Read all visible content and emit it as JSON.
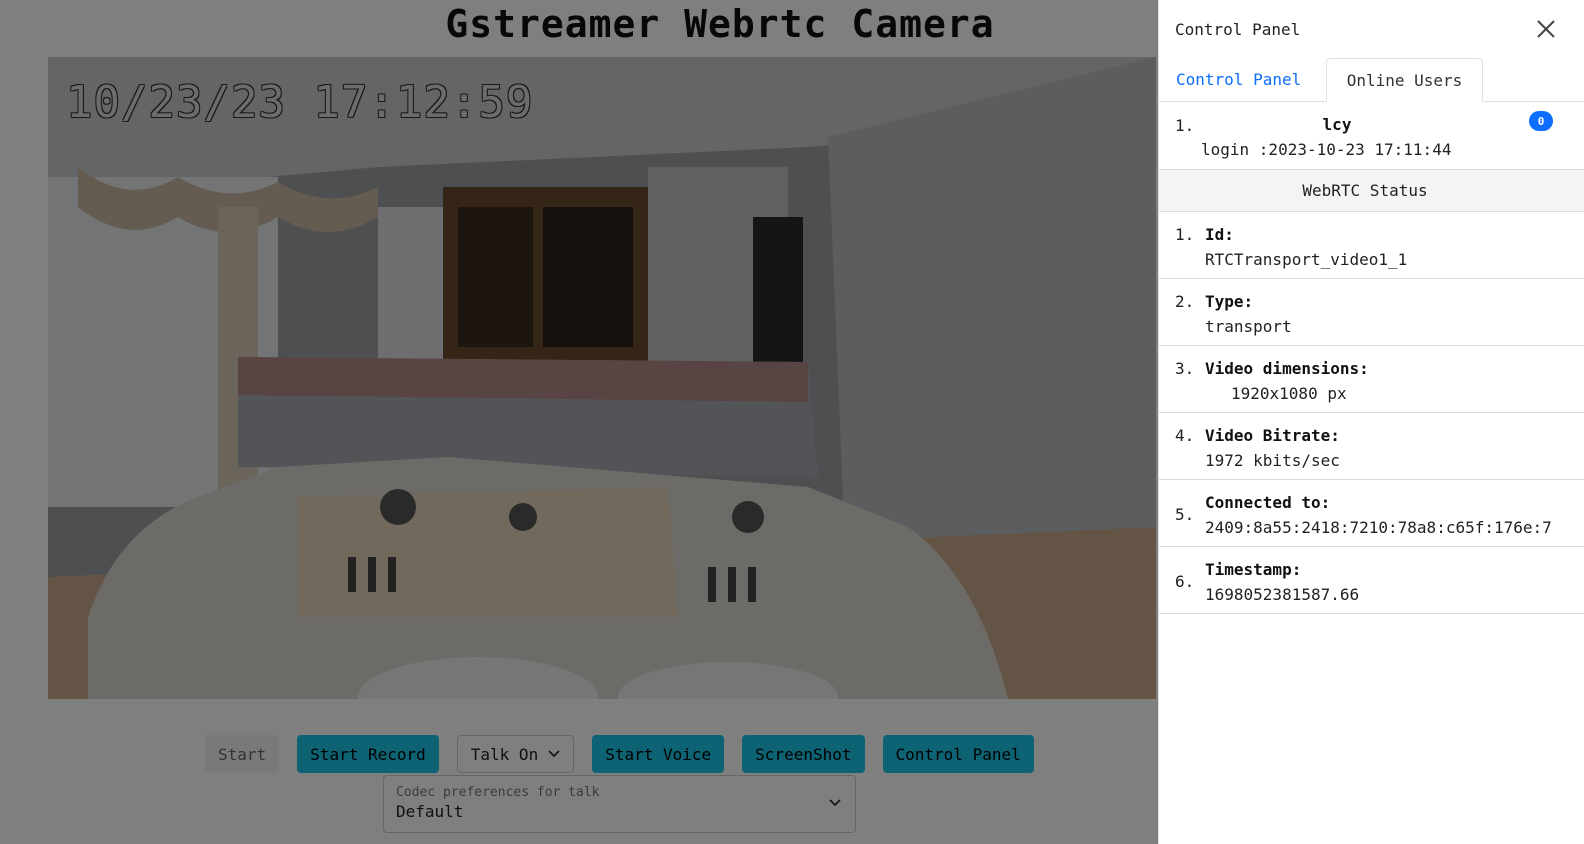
{
  "page": {
    "title": "Gstreamer Webrtc Camera",
    "video_timestamp": "10/23/23 17:12:59"
  },
  "toolbar": {
    "start_label": "Start",
    "record_label": "Start Record",
    "talk_label": "Talk On",
    "voice_label": "Start Voice",
    "screenshot_label": "ScreenShot",
    "control_panel_label": "Control Panel"
  },
  "codec": {
    "label": "Codec preferences for talk",
    "value": "Default"
  },
  "panel": {
    "title": "Control Panel",
    "tabs": [
      {
        "label": "Control Panel",
        "active": false
      },
      {
        "label": "Online Users",
        "active": true
      }
    ],
    "users": [
      {
        "index": "1.",
        "name": "lcy",
        "login": "login :2023-10-23 17:11:44",
        "badge": "0"
      }
    ],
    "status_header": "WebRTC Status",
    "stats": [
      {
        "index": "1.",
        "key": "Id:",
        "value": "RTCTransport_video1_1"
      },
      {
        "index": "2.",
        "key": "Type:",
        "value": "transport"
      },
      {
        "index": "3.",
        "key": "Video dimensions:",
        "value": "1920x1080 px"
      },
      {
        "index": "4.",
        "key": "Video Bitrate:",
        "value": "1972 kbits/sec"
      },
      {
        "index": "5.",
        "key": "Connected to:",
        "value": "2409:8a55:2418:7210:78a8:c65f:176e:7"
      },
      {
        "index": "6.",
        "key": "Timestamp:",
        "value": "1698052381587.66"
      }
    ]
  },
  "colors": {
    "accent": "#1ac6e6",
    "link": "#0d6efd"
  }
}
